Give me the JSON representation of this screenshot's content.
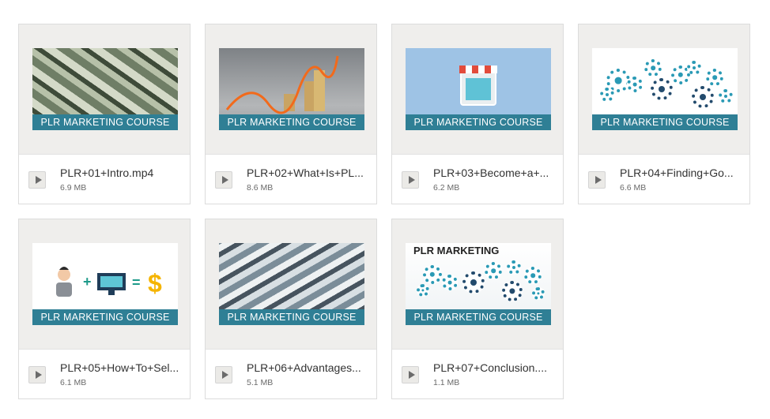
{
  "files": [
    {
      "name": "PLR+01+Intro.mp4",
      "size": "6.9 MB",
      "banner": "PLR MARKETING COURSE",
      "thumb_icon": "money-thumbnail"
    },
    {
      "name": "PLR+02+What+Is+PL...",
      "size": "8.6 MB",
      "banner": "PLR MARKETING COURSE",
      "thumb_icon": "growth-chart-thumbnail"
    },
    {
      "name": "PLR+03+Become+a+...",
      "size": "6.2 MB",
      "banner": "PLR MARKETING COURSE",
      "thumb_icon": "online-store-thumbnail"
    },
    {
      "name": "PLR+04+Finding+Go...",
      "size": "6.6 MB",
      "banner": "PLR MARKETING COURSE",
      "thumb_icon": "gears-thumbnail"
    },
    {
      "name": "PLR+05+How+To+Sel...",
      "size": "6.1 MB",
      "banner": "PLR MARKETING COURSE",
      "thumb_icon": "person-computer-dollar-thumbnail"
    },
    {
      "name": "PLR+06+Advantages...",
      "size": "5.1 MB",
      "banner": "PLR MARKETING COURSE",
      "thumb_icon": "dollar-bills-thumbnail"
    },
    {
      "name": "PLR+07+Conclusion....",
      "size": "1.1 MB",
      "banner": "PLR MARKETING COURSE",
      "thumb_title": "PLR MARKETING",
      "thumb_icon": "gears-thumbnail"
    }
  ],
  "colors": {
    "banner": "#2f7f95",
    "card_bg": "#efeeec",
    "gear_light": "#2a9ab5",
    "gear_dark": "#234b6d"
  }
}
